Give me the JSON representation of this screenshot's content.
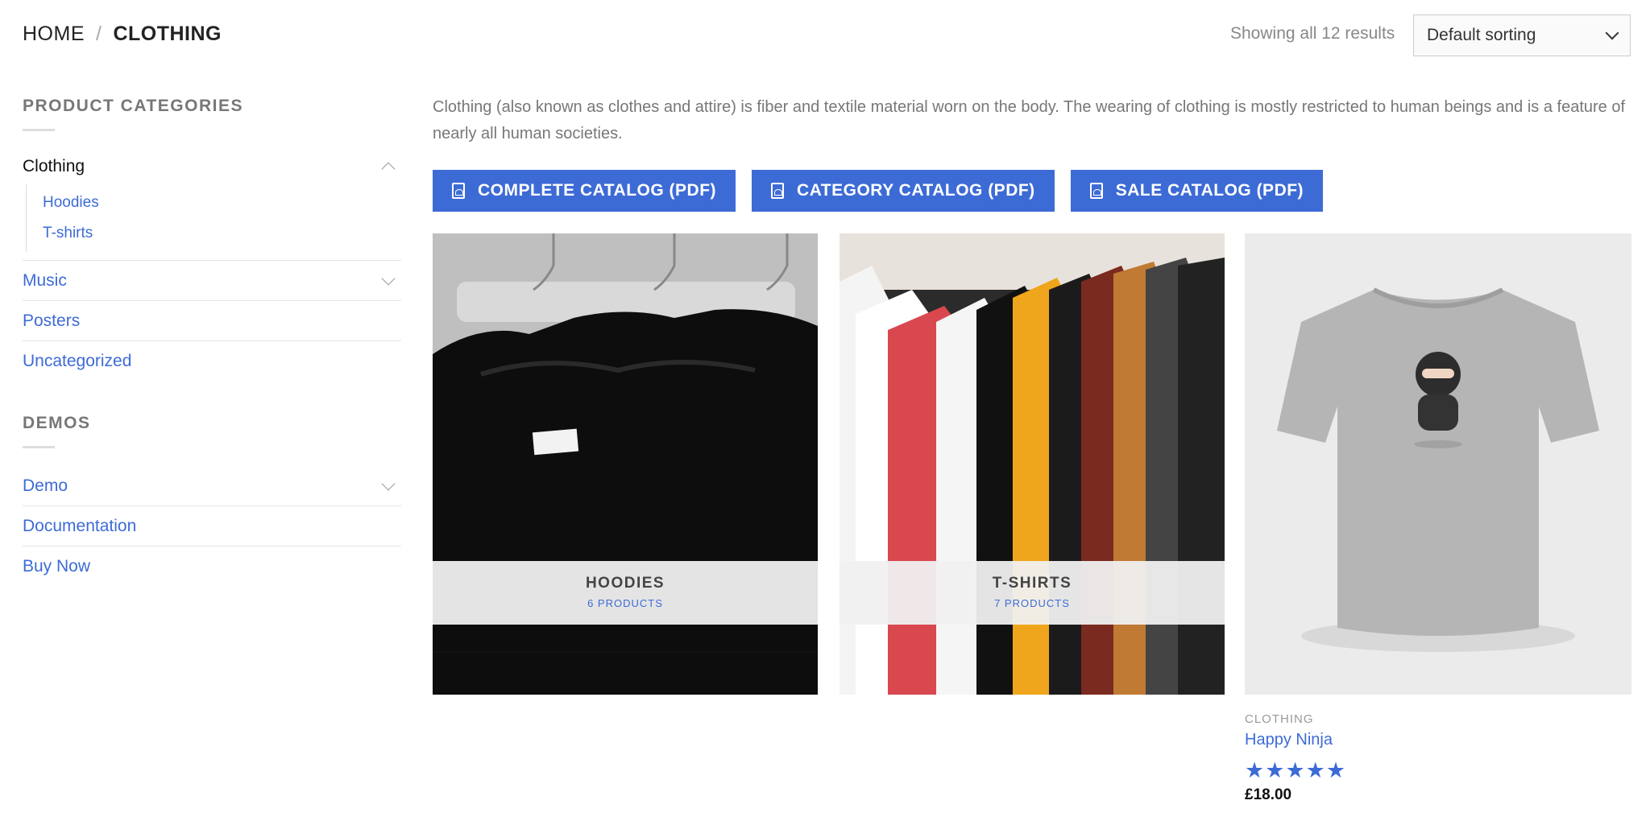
{
  "breadcrumb": {
    "home": "HOME",
    "separator": "/",
    "current": "CLOTHING"
  },
  "results_text": "Showing all 12 results",
  "sort": {
    "selected": "Default sorting"
  },
  "sidebar": {
    "product_categories": {
      "title": "PRODUCT CATEGORIES",
      "items": [
        {
          "label": "Clothing",
          "active": true,
          "children": [
            "Hoodies",
            "T-shirts"
          ]
        },
        {
          "label": "Music"
        },
        {
          "label": "Posters"
        },
        {
          "label": "Uncategorized"
        }
      ]
    },
    "demos": {
      "title": "DEMOS",
      "items": [
        {
          "label": "Demo"
        },
        {
          "label": "Documentation"
        },
        {
          "label": "Buy Now"
        }
      ]
    }
  },
  "description": "Clothing (also known as clothes and attire) is fiber and textile material worn on the body. The wearing of clothing is mostly restricted to human beings and is a feature of nearly all human societies.",
  "buttons": [
    {
      "label": "COMPLETE CATALOG (PDF)",
      "icon": "pdf-icon"
    },
    {
      "label": "CATEGORY CATALOG (PDF)",
      "icon": "pdf-icon"
    },
    {
      "label": "SALE CATALOG (PDF)",
      "icon": "pdf-icon"
    }
  ],
  "category_tiles": [
    {
      "name": "HOODIES",
      "count": "6 PRODUCTS"
    },
    {
      "name": "T-SHIRTS",
      "count": "7 PRODUCTS"
    }
  ],
  "product": {
    "category": "CLOTHING",
    "name": "Happy Ninja",
    "rating": 5,
    "rating_max": 5,
    "price": "£18.00"
  },
  "colors": {
    "accent": "#3d6bd6"
  }
}
